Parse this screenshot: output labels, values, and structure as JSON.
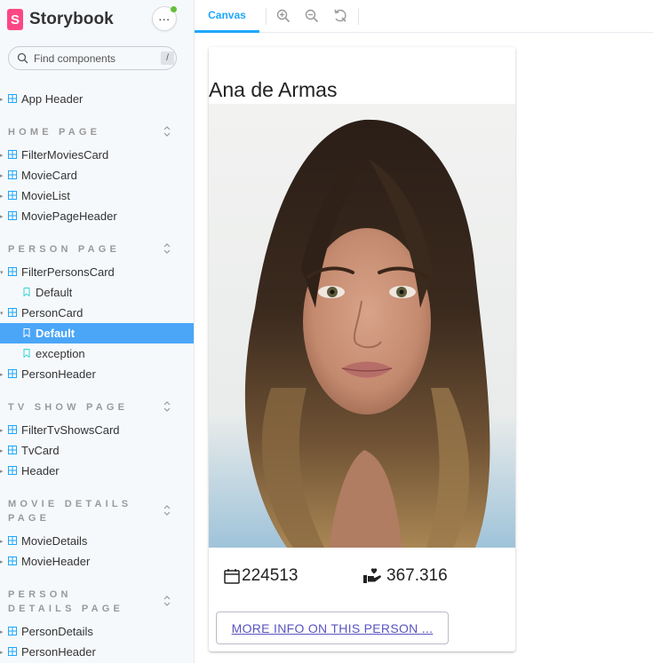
{
  "app": {
    "name": "Storybook",
    "logo_letter": "S"
  },
  "search": {
    "placeholder": "Find components",
    "shortcut": "/"
  },
  "sidebar": {
    "top_item": "App Header",
    "sections": [
      {
        "title": "HOME PAGE"
      },
      {
        "title": "PERSON PAGE"
      },
      {
        "title": "TV SHOW PAGE"
      },
      {
        "title": "MOVIE DETAILS PAGE"
      },
      {
        "title": "PERSON DETAILS PAGE"
      }
    ],
    "items": {
      "filter_movies_card": "FilterMoviesCard",
      "movie_card": "MovieCard",
      "movie_list": "MovieList",
      "movie_page_header": "MoviePageHeader",
      "filter_persons_card": "FilterPersonsCard",
      "filter_persons_default": "Default",
      "person_card": "PersonCard",
      "person_card_default": "Default",
      "person_card_exception": "exception",
      "person_header": "PersonHeader",
      "filter_tv_shows_card": "FilterTvShowsCard",
      "tv_card": "TvCard",
      "header": "Header",
      "movie_details": "MovieDetails",
      "movie_header": "MovieHeader",
      "person_details": "PersonDetails",
      "person_header_2": "PersonHeader"
    }
  },
  "toolbar": {
    "canvas_tab": "Canvas"
  },
  "card": {
    "name": "Ana de Armas",
    "stat_1": "224513",
    "stat_2": "367.316",
    "more_button": "MORE INFO ON THIS PERSON ..."
  },
  "colors": {
    "accent": "#1ea7fd",
    "selected_bg": "#4ba6f8",
    "brand": "#ff4785",
    "link": "#5b54c0"
  }
}
